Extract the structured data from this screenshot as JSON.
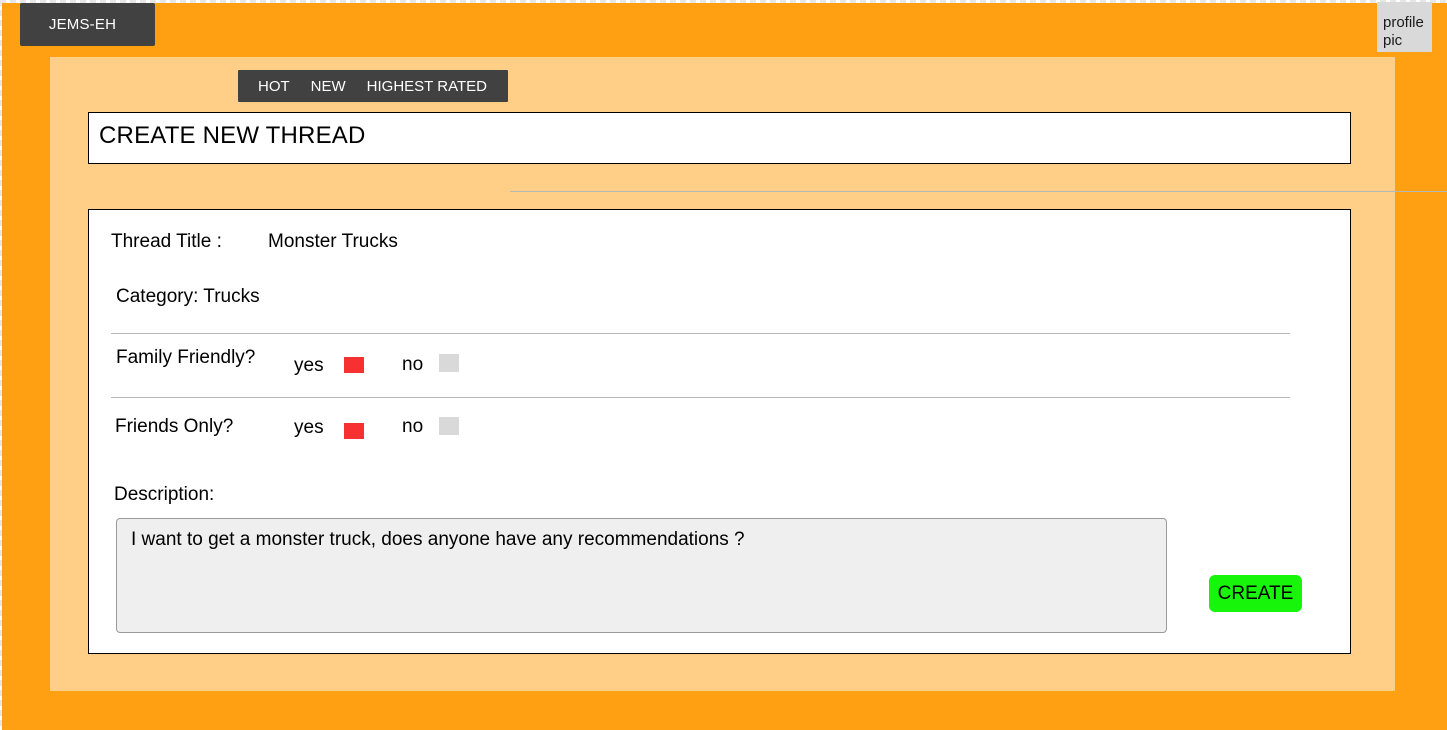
{
  "header": {
    "brand": "JEMS-EH",
    "profile_pic": "profile\npic"
  },
  "sort_tabs": [
    {
      "label": "HOT"
    },
    {
      "label": "NEW"
    },
    {
      "label": "HIGHEST RATED"
    }
  ],
  "page_title": "CREATE NEW THREAD",
  "form": {
    "thread_title_label": "Thread Title :",
    "thread_title_value": "Monster Trucks",
    "category": "Category: Trucks",
    "family_friendly": {
      "label": "Family Friendly?",
      "yes_label": "yes",
      "no_label": "no",
      "selected": "yes"
    },
    "friends_only": {
      "label": "Friends Only?",
      "yes_label": "yes",
      "no_label": "no",
      "selected": "yes"
    },
    "description_label": "Description:",
    "description_value": "I want to get a monster truck, does anyone have any recommendations ?",
    "create_label": "CREATE"
  },
  "colors": {
    "background": "#ffa012",
    "panel": "#ffcf87",
    "dark_bar": "#414141",
    "selected_option": "#f73131",
    "unselected_option": "#d9d9d9",
    "create_button": "#17f50a"
  }
}
